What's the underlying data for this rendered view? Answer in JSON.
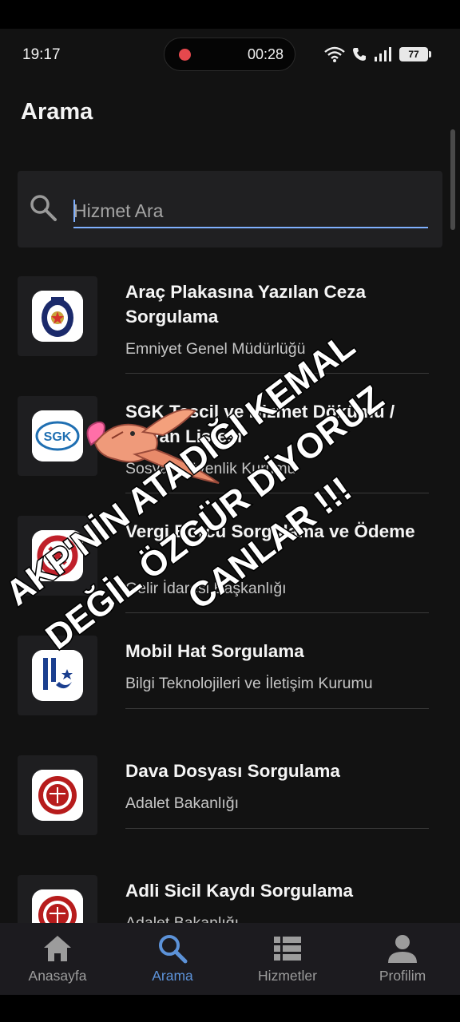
{
  "status": {
    "time": "19:17",
    "recording_time": "00:28",
    "battery": "77"
  },
  "header": {
    "title": "Arama"
  },
  "search": {
    "placeholder": "Hizmet Ara",
    "value": ""
  },
  "services": [
    {
      "title": "Araç Plakasına Yazılan Ceza Sorgulama",
      "org": "Emniyet Genel Müdürlüğü",
      "icon": "police-emblem-icon"
    },
    {
      "title": "SGK Tescil ve Hizmet Dökümü / Unvan Listesi",
      "org": "Sosyal Güvenlik Kurumu",
      "icon": "sgk-logo-icon"
    },
    {
      "title": "Vergi Borcu Sorgulama ve Ödeme",
      "org": "Gelir İdaresi Başkanlığı",
      "icon": "gib-logo-icon"
    },
    {
      "title": "Mobil Hat Sorgulama",
      "org": "Bilgi Teknolojileri ve İletişim Kurumu",
      "icon": "btk-logo-icon"
    },
    {
      "title": "Dava Dosyası Sorgulama",
      "org": "Adalet Bakanlığı",
      "icon": "justice-ministry-icon"
    },
    {
      "title": "Adli Sicil Kaydı Sorgulama",
      "org": "Adalet Bakanlığı",
      "icon": "justice-ministry-icon"
    }
  ],
  "nav": [
    {
      "label": "Anasayfa",
      "icon": "home-icon",
      "active": false
    },
    {
      "label": "Arama",
      "icon": "search-icon",
      "active": true
    },
    {
      "label": "Hizmetler",
      "icon": "list-icon",
      "active": false
    },
    {
      "label": "Profilim",
      "icon": "person-icon",
      "active": false
    }
  ],
  "overlay": {
    "lines": [
      "AKP'NİN ATADIĞI KEMAL",
      "DEĞİL ÖZGÜR DİYORUZ",
      "CANLAR !!!"
    ]
  },
  "colors": {
    "background": "#121212",
    "accent": "#5c92d8",
    "search_underline": "#7fb0ff",
    "overlay_text": "#ffffff"
  }
}
